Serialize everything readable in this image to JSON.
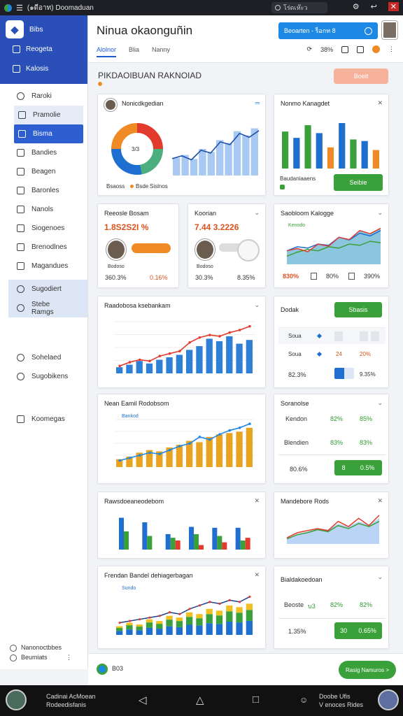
{
  "topbar": {
    "tab_title": "(๑ดีอาท) Doomaduan",
    "search_text": "โร่ดเห๊ะว"
  },
  "sidebar": {
    "brand": "Bibs",
    "top_items": [
      {
        "label": "Reogeta"
      },
      {
        "label": "Kalosis"
      }
    ],
    "items": [
      {
        "label": "Raroki",
        "state": "normal"
      },
      {
        "label": "Pramolie",
        "state": "selected"
      },
      {
        "label": "Bisma",
        "state": "active"
      },
      {
        "label": "Bandies",
        "state": "normal"
      },
      {
        "label": "Beagen",
        "state": "normal"
      },
      {
        "label": "Baronles",
        "state": "normal"
      },
      {
        "label": "Nanols",
        "state": "normal"
      },
      {
        "label": "Siogenoes",
        "state": "normal"
      },
      {
        "label": "Brenodlnes",
        "state": "normal"
      },
      {
        "label": "Magandues",
        "state": "normal"
      }
    ],
    "groups": [
      {
        "label": "Sugodiert"
      },
      {
        "label": "Stebe Ramgs"
      }
    ],
    "extra": [
      {
        "label": "Sohelaed"
      },
      {
        "label": "Sugobikens"
      }
    ],
    "other": {
      "label": "Koomegas"
    },
    "user": {
      "name": "Nanonoctbbes",
      "sub": "Beumiats"
    }
  },
  "header": {
    "title": "Ninua okaonguñin",
    "cta_label": "Beoarten - ร็อกท 8",
    "tabs": [
      {
        "label": "Alolnor"
      },
      {
        "label": "Blia"
      },
      {
        "label": "Nanny"
      }
    ],
    "stat1": "38%",
    "section_title": "PIKDAOIBUAN RAKNOIAD",
    "section_button": "Boeit"
  },
  "colors": {
    "blue": "#1e6fd0",
    "orange": "#f08a24",
    "red": "#e23b2e",
    "green": "#3aa13a",
    "light_blue": "#9dc3f0"
  },
  "cards": {
    "c1": {
      "title": "Nonicdkgedian",
      "legend": [
        "Bsaoss",
        "Bsde",
        "Sislnos"
      ],
      "donut_center": "3/3"
    },
    "c2": {
      "title": "Nonmo Kanagdet",
      "footer": "Baudaniaaens",
      "button": "Seibie"
    },
    "c3": {
      "title": "Reeosle Bosam",
      "value": "1.8S2S2I %",
      "foot_left": "360.3%",
      "foot_right": "0.16%",
      "caption": "Bodoso"
    },
    "c4": {
      "title": "Koorian",
      "value": "7.44 3.2226",
      "foot_left": "30.3%",
      "foot_right": "8.35%",
      "caption": "Bodoso"
    },
    "c5": {
      "title": "Saobloom Kalogge",
      "legend": "Kenodo",
      "foot1": "830%",
      "foot2": "80%",
      "foot3": "390%"
    },
    "c6": {
      "title": "Raadobosa ksebankam"
    },
    "c7": {
      "title": "Dodak",
      "button": "Sbasis",
      "rows": [
        {
          "label": "Soua",
          "value": ""
        },
        {
          "label": "Soua",
          "value": "20%"
        }
      ],
      "row_mid": "24",
      "foot_left": "82.3%",
      "foot_right": "9.35%"
    },
    "c8": {
      "title": "Nean Eamil Rodobsom",
      "legend": "Bankod"
    },
    "c9": {
      "title": "Soranolse",
      "rows": [
        {
          "label": "Kendon",
          "a": "82%",
          "b": "85%"
        },
        {
          "label": "Blendien",
          "a": "83%",
          "b": "83%"
        }
      ],
      "foot": "80.6%",
      "btn_a": "8",
      "btn_b": "0.5%"
    },
    "c10": {
      "title": "Rawsdoeaneodebom"
    },
    "c11": {
      "title": "Mandebore Rods"
    },
    "c12": {
      "title": "Frendan Bandel dehiagerbagan",
      "legend": "Sundo"
    },
    "c13": {
      "title": "Bialdakoedoan",
      "row_label": "Beoste",
      "row_a": "บ3",
      "row_b": "82%",
      "row_c": "82%",
      "foot": "1.35%",
      "btn_a": "30",
      "btn_b": "0.65%"
    }
  },
  "chart_data": [
    {
      "type": "pie",
      "slices": [
        {
          "value": 25,
          "color": "#e23b2e"
        },
        {
          "value": 22,
          "color": "#4caf7d"
        },
        {
          "value": 28,
          "color": "#1e6fd0"
        },
        {
          "value": 25,
          "color": "#f08a24"
        }
      ]
    },
    {
      "type": "bar",
      "values": [
        70,
        58,
        82,
        67,
        40,
        86,
        55,
        52,
        35
      ],
      "colors": [
        "#3aa13a",
        "#1e6fd0",
        "#3aa13a",
        "#1e6fd0",
        "#f08a24",
        "#1e6fd0",
        "#3aa13a",
        "#1e6fd0",
        "#f08a24"
      ]
    },
    {
      "type": "area",
      "values": [
        30,
        35,
        28,
        45,
        40,
        60,
        55,
        75,
        68,
        80
      ],
      "lines": [
        [
          20,
          26,
          24,
          30,
          28,
          40,
          36,
          46,
          42,
          50
        ],
        [
          12,
          18,
          22,
          20,
          26,
          24,
          30,
          28,
          34,
          32
        ]
      ]
    },
    {
      "type": "bar",
      "values": [
        10,
        14,
        20,
        16,
        22,
        26,
        30,
        38,
        44,
        56,
        52,
        60,
        48,
        54
      ],
      "line": [
        12,
        18,
        22,
        20,
        28,
        32,
        36,
        50,
        58,
        62,
        60,
        66,
        70,
        76
      ]
    },
    {
      "type": "bar",
      "values": [
        12,
        16,
        22,
        26,
        24,
        30,
        34,
        40,
        38,
        46,
        50,
        52,
        54,
        60
      ],
      "line": [
        10,
        14,
        18,
        22,
        20,
        26,
        32,
        36,
        46,
        42,
        50,
        56,
        60,
        66
      ]
    },
    {
      "type": "bar",
      "groups": [
        [
          70,
          40,
          0
        ],
        [
          60,
          30,
          0
        ],
        [
          34,
          26,
          20
        ],
        [
          50,
          34,
          10
        ],
        [
          48,
          30,
          16
        ],
        [
          48,
          20,
          26
        ]
      ]
    },
    {
      "type": "area",
      "values": [
        10,
        20,
        24,
        30,
        28,
        40,
        34,
        44,
        38,
        50
      ],
      "line": [
        12,
        22,
        26,
        30,
        26,
        44,
        34,
        50,
        36,
        56
      ],
      "line2": [
        10,
        18,
        22,
        28,
        24,
        36,
        30,
        40,
        34,
        44
      ]
    },
    {
      "type": "bar",
      "values": [
        10,
        14,
        12,
        18,
        16,
        22,
        20,
        26,
        24,
        30,
        28,
        34,
        32,
        36
      ],
      "line": [
        14,
        16,
        18,
        20,
        22,
        26,
        24,
        30,
        34,
        38,
        36,
        40,
        38,
        44
      ]
    }
  ],
  "bottom": {
    "label": "B03",
    "button": "Rasig Namuros >"
  },
  "system": {
    "left1": "Cadinai AcMoean",
    "left2": "Rodeedisfanis",
    "right1": "Doobe   Ufis",
    "right2": "V enoces   Rides"
  }
}
